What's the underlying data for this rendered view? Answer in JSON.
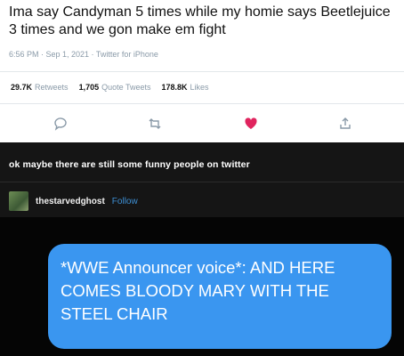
{
  "tweet": {
    "text": "Ima say Candyman 5 times while my homie says Beetlejuice 3 times and we gon make em fight",
    "meta": "6:56 PM · Sep 1, 2021 · Twitter for iPhone",
    "stats": {
      "retweets_count": "29.7K",
      "retweets_label": "Retweets",
      "quotes_count": "1,705",
      "quotes_label": "Quote Tweets",
      "likes_count": "178.8K",
      "likes_label": "Likes"
    },
    "actions": {
      "reply_icon": "speech-bubble-icon",
      "retweet_icon": "retweet-icon",
      "like_icon": "heart-icon",
      "share_icon": "share-icon",
      "like_color": "#e0245e"
    }
  },
  "tumblr": {
    "post_text": "ok maybe there are still some funny people on twitter",
    "username": "thestarvedghost",
    "follow_label": "Follow",
    "follow_color": "#3d8fd4"
  },
  "message": {
    "text": "*WWE Announcer voice*: AND HERE COMES BLOODY MARY WITH THE STEEL CHAIR",
    "bubble_color": "#3a96f0"
  }
}
